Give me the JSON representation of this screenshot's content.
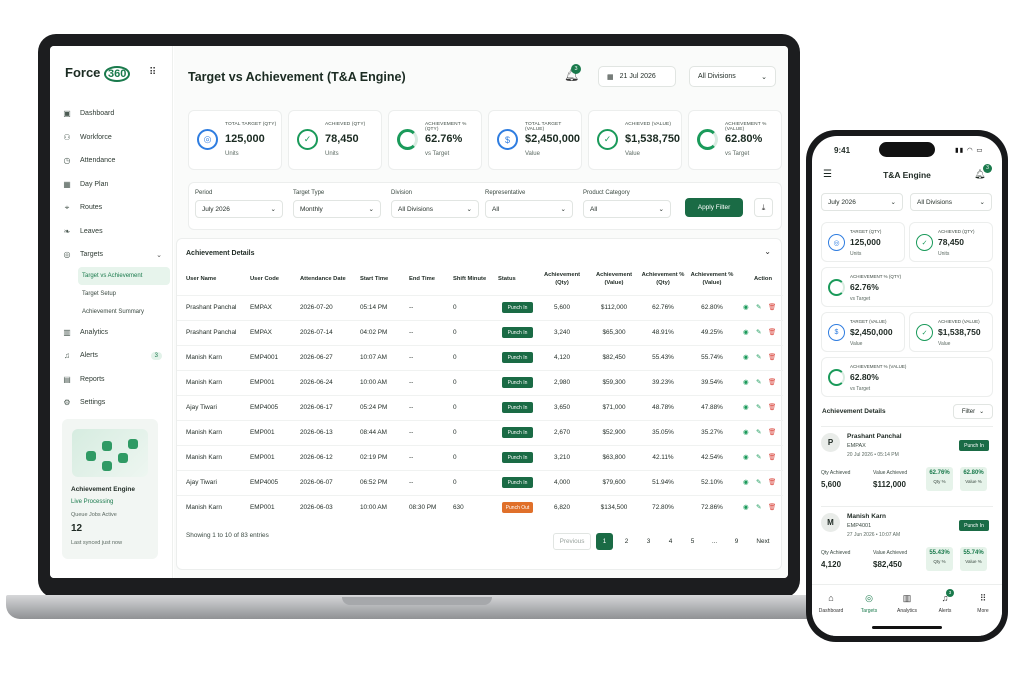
{
  "app": {
    "logo_text": "Force",
    "logo_num": "360"
  },
  "sidebar": {
    "items": [
      {
        "label": "Dashboard",
        "icon": "dashboard-icon"
      },
      {
        "label": "Workforce",
        "icon": "users-icon"
      },
      {
        "label": "Attendance",
        "icon": "clock-icon"
      },
      {
        "label": "Day Plan",
        "icon": "calendar-icon"
      },
      {
        "label": "Routes",
        "icon": "route-icon"
      },
      {
        "label": "Leaves",
        "icon": "leaf-icon"
      },
      {
        "label": "Targets",
        "icon": "target-icon"
      },
      {
        "label": "Analytics",
        "icon": "chart-icon"
      },
      {
        "label": "Alerts",
        "icon": "bell-icon",
        "badge": "3"
      },
      {
        "label": "Reports",
        "icon": "report-icon"
      },
      {
        "label": "Settings",
        "icon": "gear-icon"
      }
    ],
    "sub_items": [
      "Target vs Achievement",
      "Target Setup",
      "Achievement Summary"
    ],
    "engine": {
      "title": "Achievement Engine",
      "status": "Live Processing",
      "queue_label": "Queue Jobs Active",
      "queue_value": "12",
      "synced": "Last synced just now"
    }
  },
  "header": {
    "title": "Target vs Achievement (T&A Engine)",
    "bell_badge": "3",
    "date": "21 Jul 2026",
    "division": "All Divisions"
  },
  "kpis": [
    {
      "label": "TOTAL TARGET (QTY)",
      "value": "125,000",
      "sub": "Units",
      "icon": "target-icon"
    },
    {
      "label": "ACHIEVED (QTY)",
      "value": "78,450",
      "sub": "Units",
      "icon": "check-icon"
    },
    {
      "label": "ACHIEVEMENT % (QTY)",
      "value": "62.76%",
      "sub": "vs Target",
      "icon": "progress-ring-icon",
      "progress": 62.76
    },
    {
      "label": "TOTAL TARGET (VALUE)",
      "value": "$2,450,000",
      "sub": "Value",
      "icon": "dollar-icon"
    },
    {
      "label": "ACHIEVED (VALUE)",
      "value": "$1,538,750",
      "sub": "Value",
      "icon": "check-icon"
    },
    {
      "label": "ACHIEVEMENT % (VALUE)",
      "value": "62.80%",
      "sub": "vs Target",
      "icon": "progress-ring-icon",
      "progress": 62.8
    }
  ],
  "filters": {
    "period": {
      "label": "Period",
      "value": "July 2026"
    },
    "target_type": {
      "label": "Target Type",
      "value": "Monthly"
    },
    "division": {
      "label": "Division",
      "value": "All Divisions"
    },
    "representative": {
      "label": "Representative",
      "value": "All"
    },
    "category": {
      "label": "Product Category",
      "value": "All"
    },
    "apply": "Apply Filter"
  },
  "table": {
    "title": "Achievement Details",
    "headers": [
      "User Name",
      "User Code",
      "Attendance Date",
      "Start Time",
      "End Time",
      "Shift Minute",
      "Status",
      "Achievement (Qty)",
      "Achievement (Value)",
      "Achievement % (Qty)",
      "Achievement % (Value)",
      "Action"
    ],
    "rows": [
      [
        "Prashant Panchal",
        "EMPAX",
        "2026-07-20",
        "05:14 PM",
        "--",
        "0",
        "Punch In",
        "5,600",
        "$112,000",
        "62.76%",
        "62.80%"
      ],
      [
        "Prashant Panchal",
        "EMPAX",
        "2026-07-14",
        "04:02 PM",
        "--",
        "0",
        "Punch In",
        "3,240",
        "$65,300",
        "48.91%",
        "49.25%"
      ],
      [
        "Manish Karn",
        "EMP4001",
        "2026-06-27",
        "10:07 AM",
        "--",
        "0",
        "Punch In",
        "4,120",
        "$82,450",
        "55.43%",
        "55.74%"
      ],
      [
        "Manish Karn",
        "EMP001",
        "2026-06-24",
        "10:00 AM",
        "--",
        "0",
        "Punch In",
        "2,980",
        "$59,300",
        "39.23%",
        "39.54%"
      ],
      [
        "Ajay Tiwari",
        "EMP4005",
        "2026-06-17",
        "05:24 PM",
        "--",
        "0",
        "Punch In",
        "3,650",
        "$71,000",
        "48.78%",
        "47.88%"
      ],
      [
        "Manish Karn",
        "EMP001",
        "2026-06-13",
        "08:44 AM",
        "--",
        "0",
        "Punch In",
        "2,670",
        "$52,900",
        "35.05%",
        "35.27%"
      ],
      [
        "Manish Karn",
        "EMP001",
        "2026-06-12",
        "02:19 PM",
        "--",
        "0",
        "Punch In",
        "3,210",
        "$63,800",
        "42.11%",
        "42.54%"
      ],
      [
        "Ajay Tiwari",
        "EMP4005",
        "2026-06-07",
        "06:52 PM",
        "--",
        "0",
        "Punch In",
        "4,000",
        "$79,600",
        "51.94%",
        "52.10%"
      ],
      [
        "Manish Karn",
        "EMP001",
        "2026-06-03",
        "10:00 AM",
        "08:30 PM",
        "630",
        "Punch Out",
        "6,820",
        "$134,500",
        "72.80%",
        "72.86%"
      ]
    ],
    "showing": "Showing 1 to 10 of 83 entries",
    "pager": {
      "prev": "Previous",
      "pages": [
        "1",
        "2",
        "3",
        "4",
        "5",
        "...",
        "9"
      ],
      "next": "Next"
    }
  },
  "phone": {
    "time": "9:41",
    "title": "T&A Engine",
    "bell_badge": "3",
    "period": "July 2026",
    "division": "All Divisions",
    "kpis": [
      {
        "label": "TARGET (QTY)",
        "value": "125,000",
        "sub": "Units"
      },
      {
        "label": "ACHIEVED (QTY)",
        "value": "78,450",
        "sub": "Units"
      },
      {
        "label": "ACHIEVEMENT % (QTY)",
        "value": "62.76%",
        "sub": "vs Target"
      },
      {
        "label": "TARGET (VALUE)",
        "value": "$2,450,000",
        "sub": "Value"
      },
      {
        "label": "ACHIEVED (VALUE)",
        "value": "$1,538,750",
        "sub": "Value"
      },
      {
        "label": "ACHIEVEMENT % (VALUE)",
        "value": "62.80%",
        "sub": "vs Target"
      }
    ],
    "details_title": "Achievement Details",
    "filter": "Filter",
    "cards": [
      {
        "initial": "P",
        "name": "Prashant Panchal",
        "code": "EMPAX",
        "datetime": "20 Jul 2026 • 05:14 PM",
        "status": "Punch In",
        "qty_label": "Qty Achieved",
        "qty": "5,600",
        "val_label": "Value Achieved",
        "val": "$112,000",
        "pct_qty": "62.76%",
        "pct_qty_label": "Qty %",
        "pct_val": "62.80%",
        "pct_val_label": "Value %"
      },
      {
        "initial": "M",
        "name": "Manish Karn",
        "code": "EMP4001",
        "datetime": "27 Jun 2026 • 10:07 AM",
        "status": "Punch In",
        "qty_label": "Qty Achieved",
        "qty": "4,120",
        "val_label": "Value Achieved",
        "val": "$82,450",
        "pct_qty": "55.43%",
        "pct_qty_label": "Qty %",
        "pct_val": "55.74%",
        "pct_val_label": "Value %"
      }
    ],
    "tabs": [
      "Dashboard",
      "Targets",
      "Analytics",
      "Alerts",
      "More"
    ],
    "alerts_badge": "3"
  }
}
